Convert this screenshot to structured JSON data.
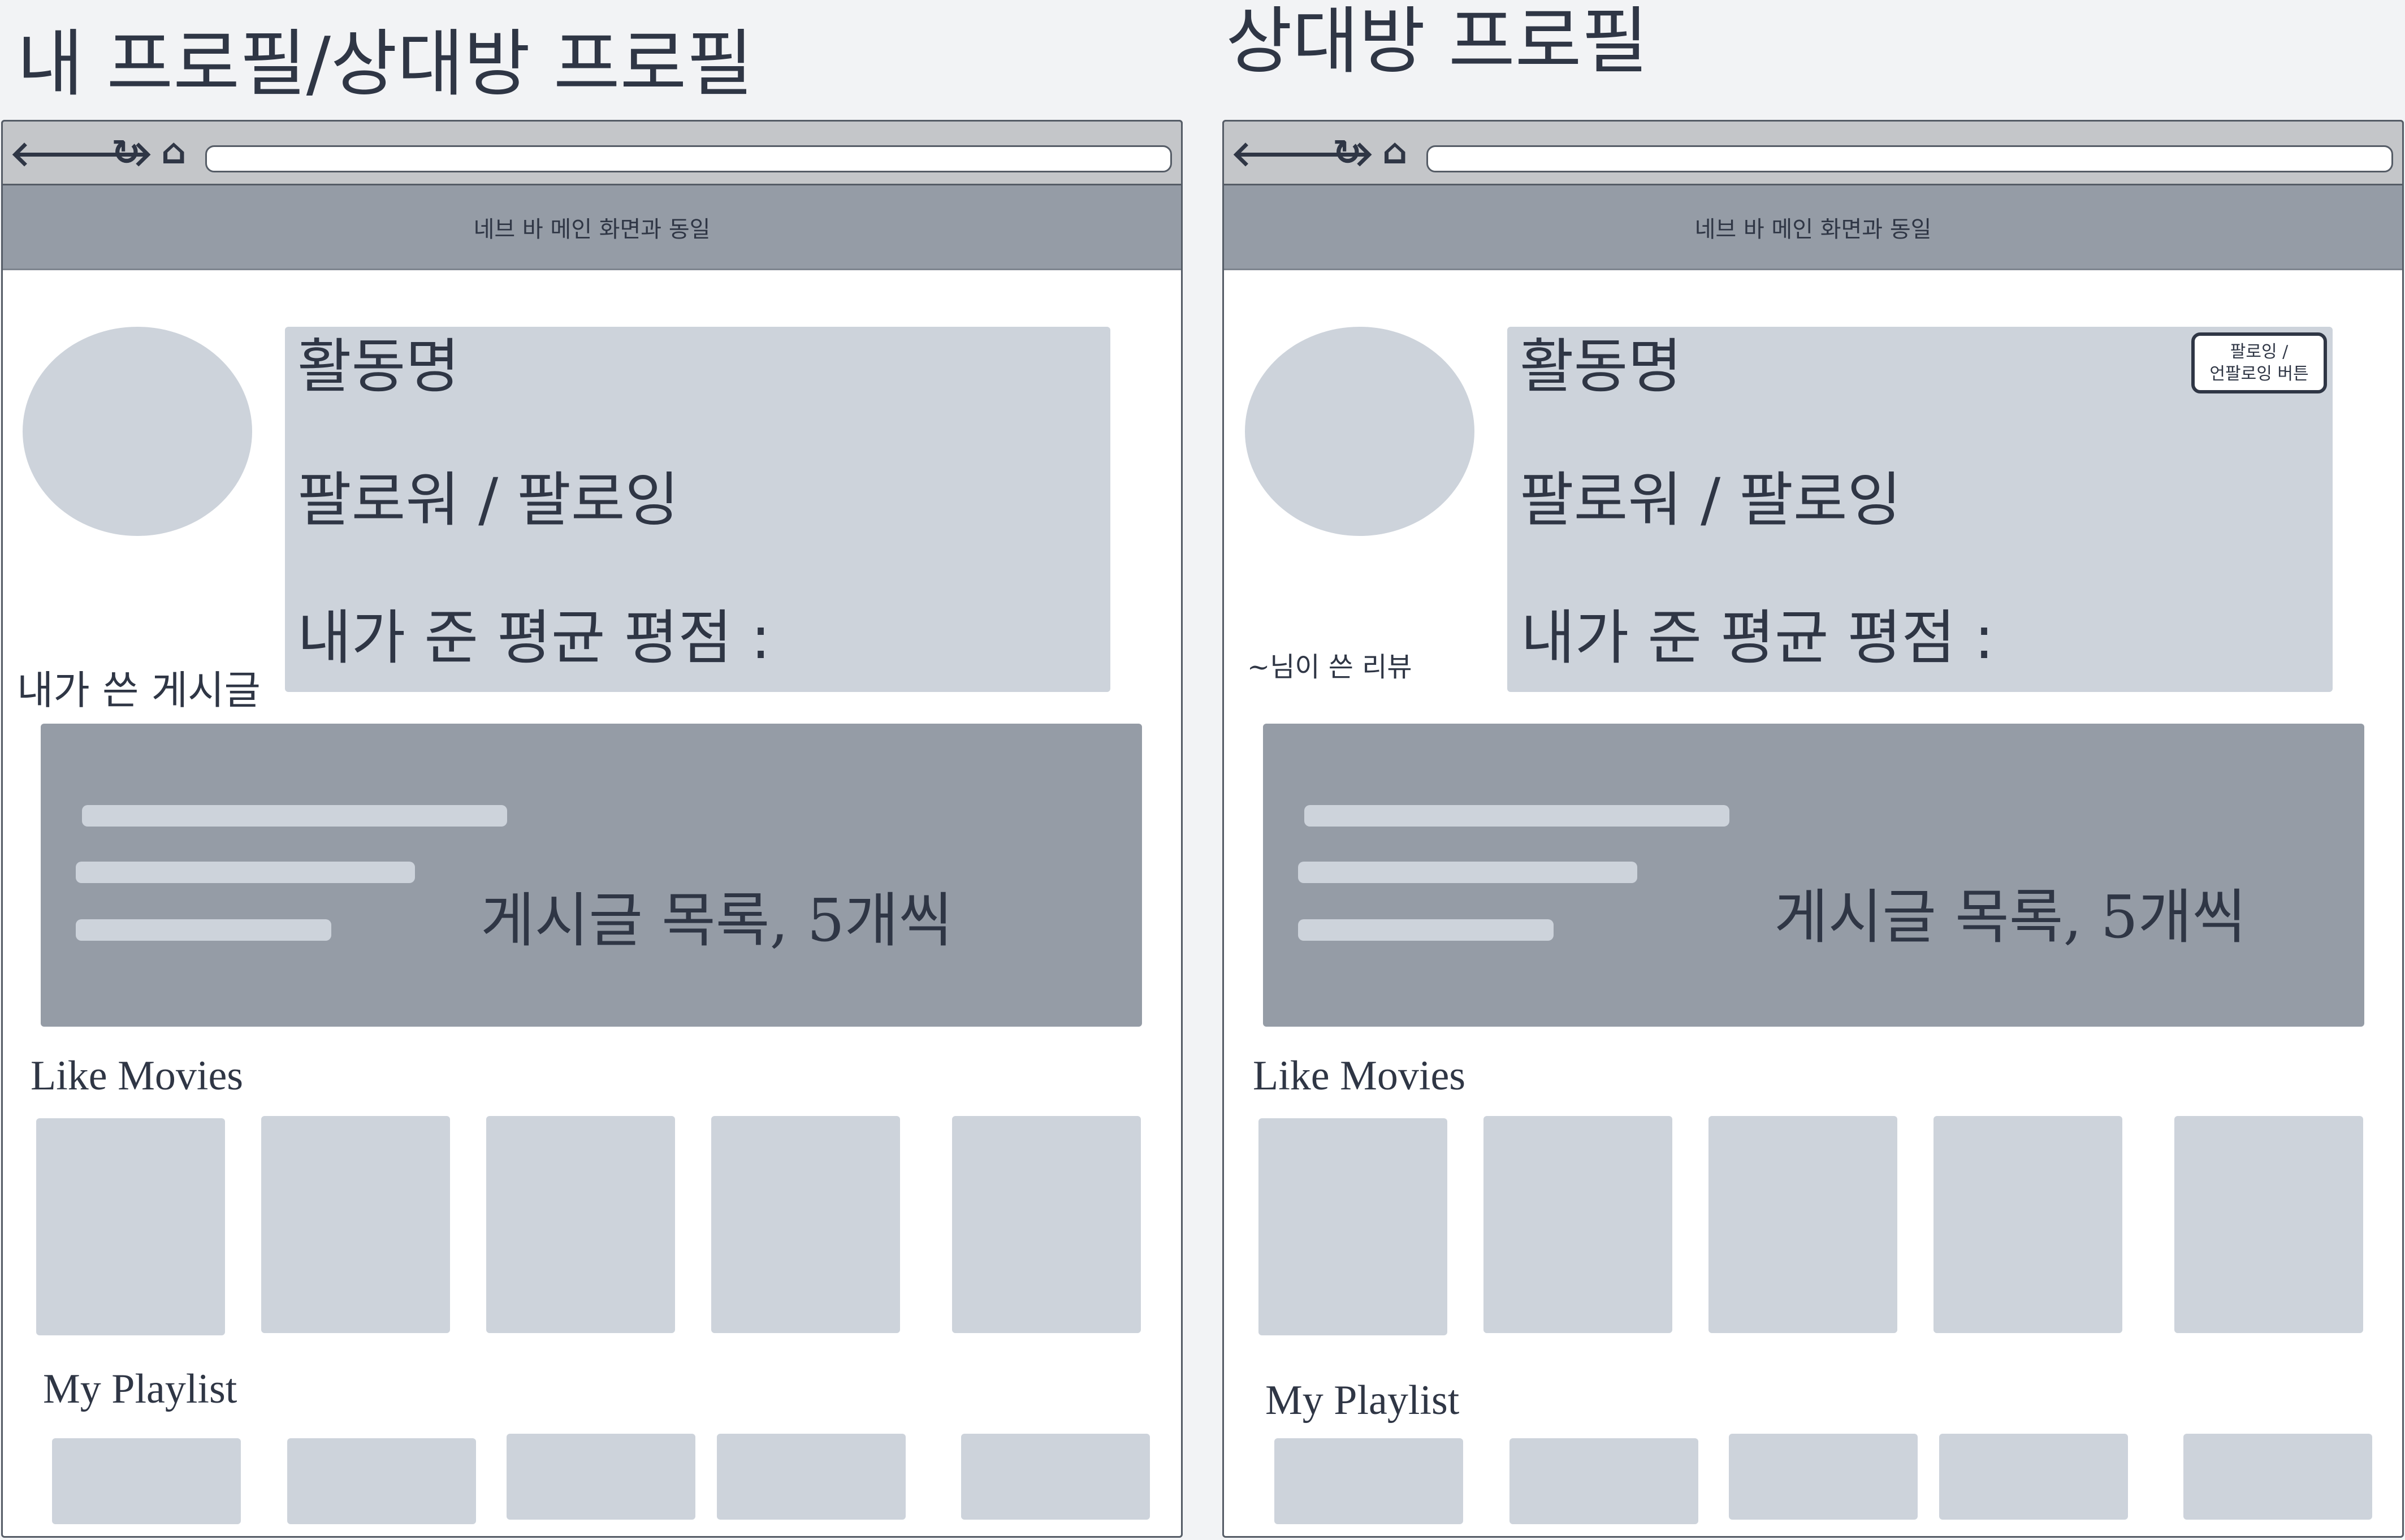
{
  "my_profile": {
    "title": "내 프로필/상대방 프로필",
    "navbar_label": "네브 바 메인 화면과 동일",
    "activity_name": "활동명",
    "followers_following": "팔로워 / 팔로잉",
    "average_rating": "내가 준 평균 평점 :",
    "posts_section_label": "내가 쓴 게시글",
    "posts_list_label": "게시글 목록, 5개씩",
    "like_movies_title": "Like Movies",
    "playlist_title": "My Playlist"
  },
  "other_profile": {
    "title": "상대방 프로필",
    "navbar_label": "네브 바 메인 화면과 동일",
    "activity_name": "활동명",
    "followers_following": "팔로워 / 팔로잉",
    "average_rating": "내가 준 평균 평점 :",
    "follow_button_line1": "팔로잉 /",
    "follow_button_line2": "언팔로잉 버튼",
    "reviews_section_label": "~님이 쓴 리뷰",
    "posts_list_label": "게시글 목록, 5개씩",
    "like_movies_title": "Like Movies",
    "playlist_title": "My Playlist"
  },
  "icons": [
    "back-arrow-icon",
    "forward-arrow-icon",
    "refresh-icon",
    "home-icon"
  ],
  "colors": {
    "background": "#f2f3f5",
    "navbar": "#959ca6",
    "placeholder": "#cdd3db",
    "text": "#2f3645"
  }
}
